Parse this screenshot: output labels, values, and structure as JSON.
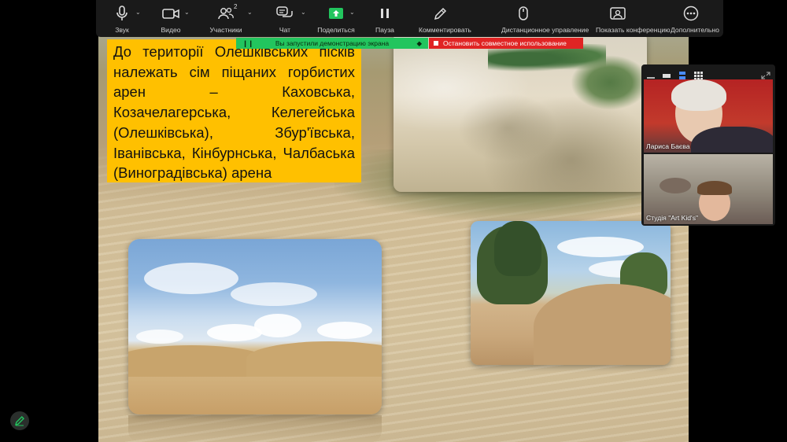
{
  "toolbar": {
    "audio": {
      "label": "Звук"
    },
    "video": {
      "label": "Видео"
    },
    "participants": {
      "label": "Участники",
      "count": "2"
    },
    "chat": {
      "label": "Чат"
    },
    "share": {
      "label": "Поделиться"
    },
    "pause": {
      "label": "Пауза"
    },
    "annotate": {
      "label": "Комментировать"
    },
    "remote": {
      "label": "Дистанционное управление"
    },
    "show_conf": {
      "label": "Показать конференцию"
    },
    "more": {
      "label": "Дополнительно"
    }
  },
  "banners": {
    "sharing": "Вы запустили демонстрацию экрана",
    "stop": "Остановить совместное использование"
  },
  "slide": {
    "text": "До території Олешківських пісків належать сім піщаних горбистих арен – Каховська, Козачелагерська, Келегейська (Олешківська), Збур'ївська, Іванівська, Кінбурнська, Чалбаська (Виноградівська) арена"
  },
  "participants": [
    {
      "name": "Лариса Баєва"
    },
    {
      "name": "Студія \"Art Kid's\""
    }
  ],
  "colors": {
    "toolbar_bg": "#1a1a1a",
    "share_green": "#22c55e",
    "stop_red": "#e02424",
    "slide_text_bg": "#ffc000"
  }
}
